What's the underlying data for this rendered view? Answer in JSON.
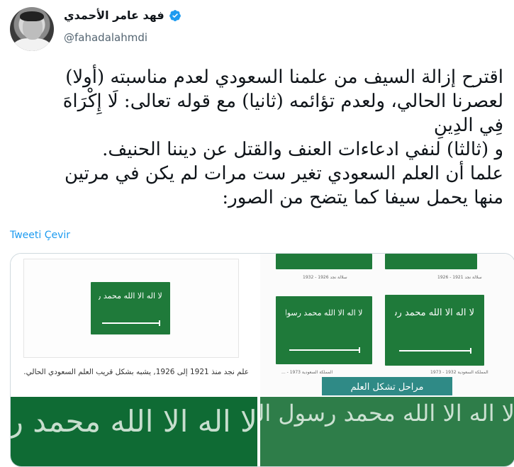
{
  "author": {
    "display_name": "فهد عامر الأحمدي",
    "handle": "@fahadalahmdi",
    "verified": true
  },
  "tweet": {
    "lines": [
      "اقترح إزالة السيف من علمنا السعودي لعدم مناسبته (أولا)",
      "لعصرنا الحالي، ولعدم تؤائمه (ثانيا) مع قوله تعالى:  لَا إِكْرَاهَ",
      "فِي الدِينِ",
      "و (ثالثا) لنفي ادعاءات العنف والقتل عن ديننا الحنيف.",
      "علما أن العلم السعودي تغير ست مرات لم يكن في مرتين",
      "منها يحمل سيفا كما يتضح من الصور:"
    ],
    "translate_label": "Tweeti Çevir"
  },
  "media": {
    "photo1": {
      "caption": "علم نجد منذ 1921 إلى 1926, يشبه بشكل قريب العلم السعودي الحالي.",
      "flag_script": "لا اله الا الله محمد رسول الله"
    },
    "photo2": {
      "overlay_label": "مراحل تشكل العلم",
      "small_caps": [
        "سلالة نجد 1921 - 1926",
        "سلالة نجد 1926 - 1932",
        "المملكة السعودية 1932 - 1973",
        "المملكة السعودية 1973 - ..."
      ],
      "flag_script": "لا اله الا الله محمد رسول الله"
    },
    "photo3": {
      "flag_script": "لا اله الا الله محمد رسول الله"
    },
    "photo4": {
      "flag_script": "لا اله الا الله محمد رسول الله"
    }
  },
  "colors": {
    "flag_green": "#1f7a3a",
    "link_blue": "#1d9bf0",
    "verified_blue": "#1d9bf0"
  }
}
